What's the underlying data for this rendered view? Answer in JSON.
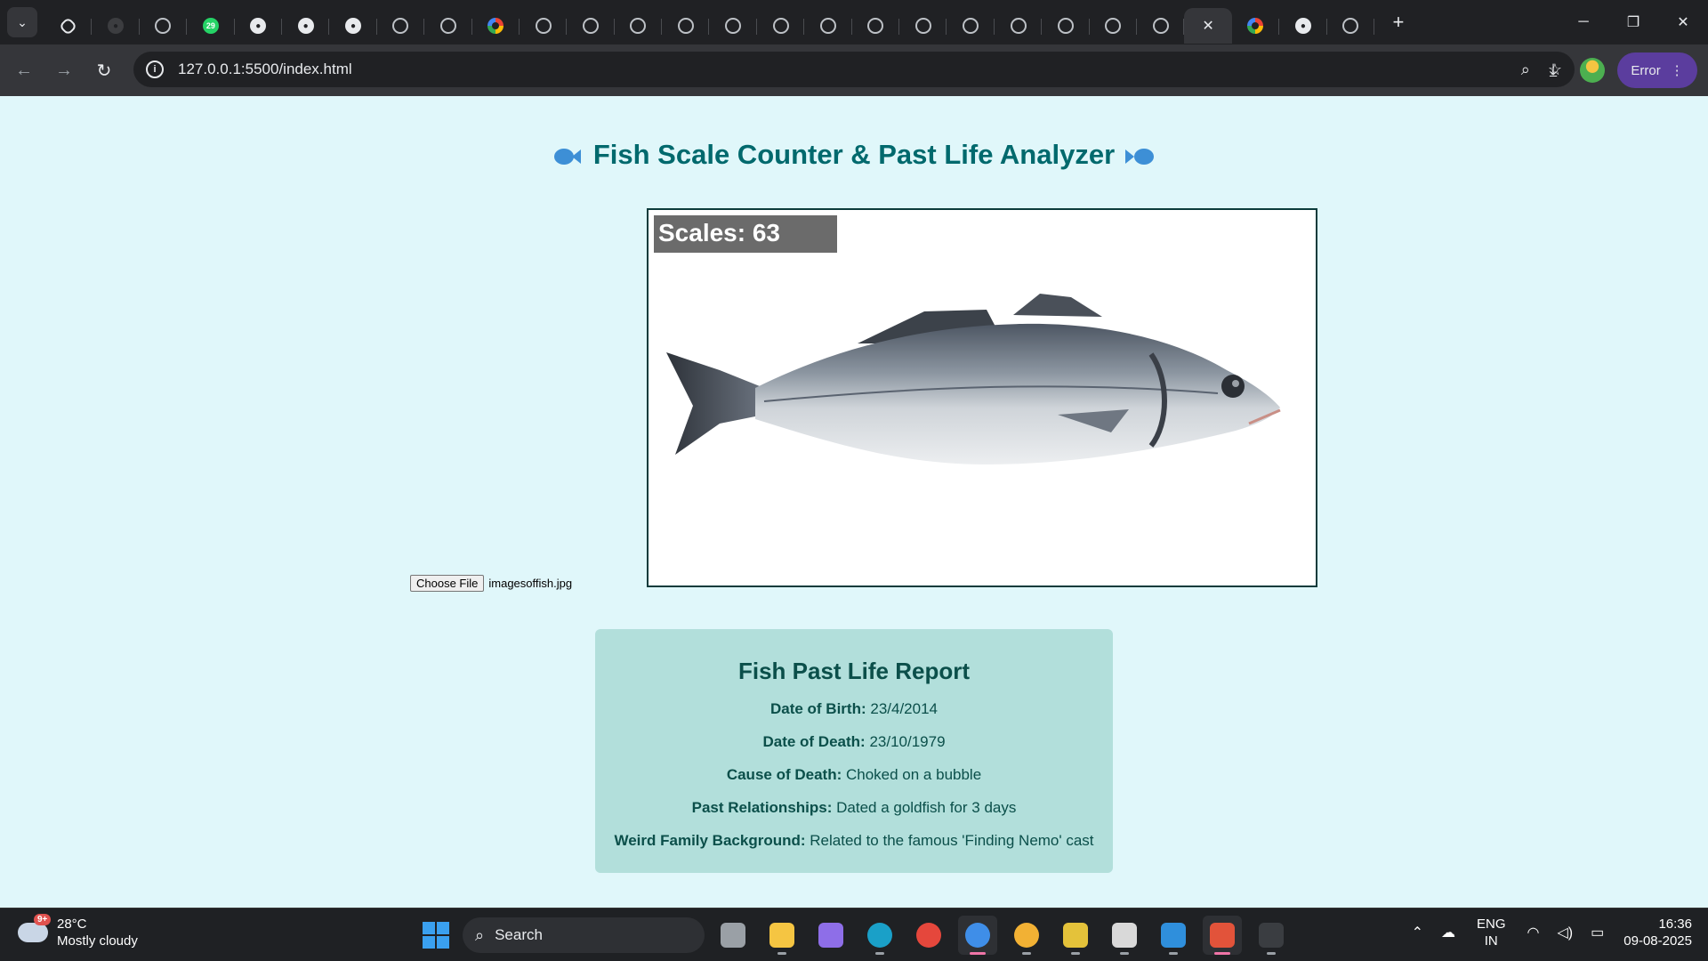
{
  "browser": {
    "url": "127.0.0.1:5500/index.html",
    "profile_button_label": "Error",
    "tabs": [
      {
        "icon": "chatgpt-icon"
      },
      {
        "icon": "github-icon"
      },
      {
        "icon": "globe-icon"
      },
      {
        "icon": "whatsapp-icon",
        "badge": "29"
      },
      {
        "icon": "github-icon"
      },
      {
        "icon": "github-icon"
      },
      {
        "icon": "github-icon"
      },
      {
        "icon": "globe-icon"
      },
      {
        "icon": "globe-icon"
      },
      {
        "icon": "google-icon"
      },
      {
        "icon": "globe-icon"
      },
      {
        "icon": "globe-icon"
      },
      {
        "icon": "globe-icon"
      },
      {
        "icon": "globe-icon"
      },
      {
        "icon": "globe-icon"
      },
      {
        "icon": "globe-icon"
      },
      {
        "icon": "globe-icon"
      },
      {
        "icon": "globe-icon"
      },
      {
        "icon": "globe-icon"
      },
      {
        "icon": "globe-icon"
      },
      {
        "icon": "globe-icon"
      },
      {
        "icon": "globe-icon"
      },
      {
        "icon": "globe-icon"
      },
      {
        "icon": "globe-icon"
      },
      {
        "icon": "close-icon",
        "active": true
      },
      {
        "icon": "google-icon"
      },
      {
        "icon": "github-icon"
      },
      {
        "icon": "globe-icon"
      }
    ]
  },
  "page": {
    "title": "Fish Scale Counter & Past Life Analyzer",
    "scales_label": "Scales: 63",
    "file_button": "Choose File",
    "file_name": "imagesoffish.jpg",
    "report": {
      "heading": "Fish Past Life Report",
      "items": [
        {
          "label": "Date of Birth:",
          "value": "23/4/2014"
        },
        {
          "label": "Date of Death:",
          "value": "23/10/1979"
        },
        {
          "label": "Cause of Death:",
          "value": "Choked on a bubble"
        },
        {
          "label": "Past Relationships:",
          "value": "Dated a goldfish for 3 days"
        },
        {
          "label": "Weird Family Background:",
          "value": "Related to the famous 'Finding Nemo' cast"
        }
      ]
    }
  },
  "taskbar": {
    "weather_temp": "28°C",
    "weather_desc": "Mostly cloudy",
    "weather_badge": "9+",
    "search_label": "Search",
    "lang_1": "ENG",
    "lang_2": "IN",
    "time": "16:36",
    "date": "09-08-2025",
    "apps": [
      "task-view-icon",
      "file-explorer-icon",
      "copilot-icon",
      "edge-icon",
      "chrome-icon",
      "chrome-dev-icon",
      "chrome-canary-icon",
      "git-icon",
      "snipping-tool-icon",
      "vscode-icon",
      "xampp-icon",
      "terminal-icon"
    ]
  },
  "colors": {
    "page_bg": "#e0f7fa",
    "title": "#00696d",
    "report_bg": "#b2dfdb",
    "report_text": "#0b4f4a"
  }
}
